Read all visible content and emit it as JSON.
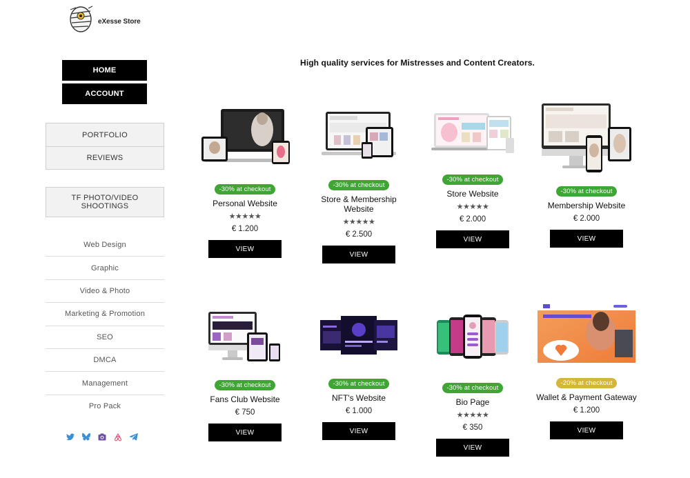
{
  "brand": {
    "name": "eXesse Store"
  },
  "nav": {
    "home": "HOME",
    "account": "ACCOUNT"
  },
  "boxes": {
    "portfolio": "PORTFOLIO",
    "reviews": "REVIEWS",
    "shootings": "TF PHOTO/VIDEO SHOOTINGS"
  },
  "menu": [
    "Web Design",
    "Graphic",
    "Video & Photo",
    "Marketing & Promotion",
    "SEO",
    "DMCA",
    "Management",
    "Pro Pack"
  ],
  "social_icons": [
    "twitter-icon",
    "bluesky-icon",
    "instagram-icon",
    "airbnb-icon",
    "telegram-icon"
  ],
  "social_color": "#3b8fd6",
  "headline": "High quality  services for Mistresses and Content Creators.",
  "colors": {
    "badge_green": "#3fa635",
    "badge_yellow": "#d4b73a",
    "button": "#000000"
  },
  "products": [
    {
      "badge": "-30% at checkout",
      "badge_color": "green",
      "title": "Personal Website",
      "stars": "★★★★★",
      "price": "€ 1.200",
      "view": "VIEW"
    },
    {
      "badge": "-30% at checkout",
      "badge_color": "green",
      "title": "Store & Membership Website",
      "stars": "★★★★★",
      "price": "€ 2.500",
      "view": "VIEW"
    },
    {
      "badge": "-30% at checkout",
      "badge_color": "green",
      "title": "Store Website",
      "stars": "★★★★★",
      "price": "€ 2.000",
      "view": "VIEW"
    },
    {
      "badge": "-30% at checkout",
      "badge_color": "green",
      "title": "Membership Website",
      "price": "€ 2.000",
      "view": "VIEW"
    },
    {
      "badge": "-30% at checkout",
      "badge_color": "green",
      "title": "Fans Club Website",
      "price": "€ 750",
      "view": "VIEW"
    },
    {
      "badge": "-30% at checkout",
      "badge_color": "green",
      "title": "NFT's Website",
      "price": "€ 1.000",
      "view": "VIEW"
    },
    {
      "badge": "-30% at checkout",
      "badge_color": "green",
      "title": "Bio Page",
      "stars": "★★★★★",
      "price": "€ 350",
      "view": "VIEW"
    },
    {
      "badge": "-20% at checkout",
      "badge_color": "yellow",
      "title": "Wallet & Payment Gateway",
      "price": "€ 1.200",
      "view": "VIEW"
    }
  ]
}
